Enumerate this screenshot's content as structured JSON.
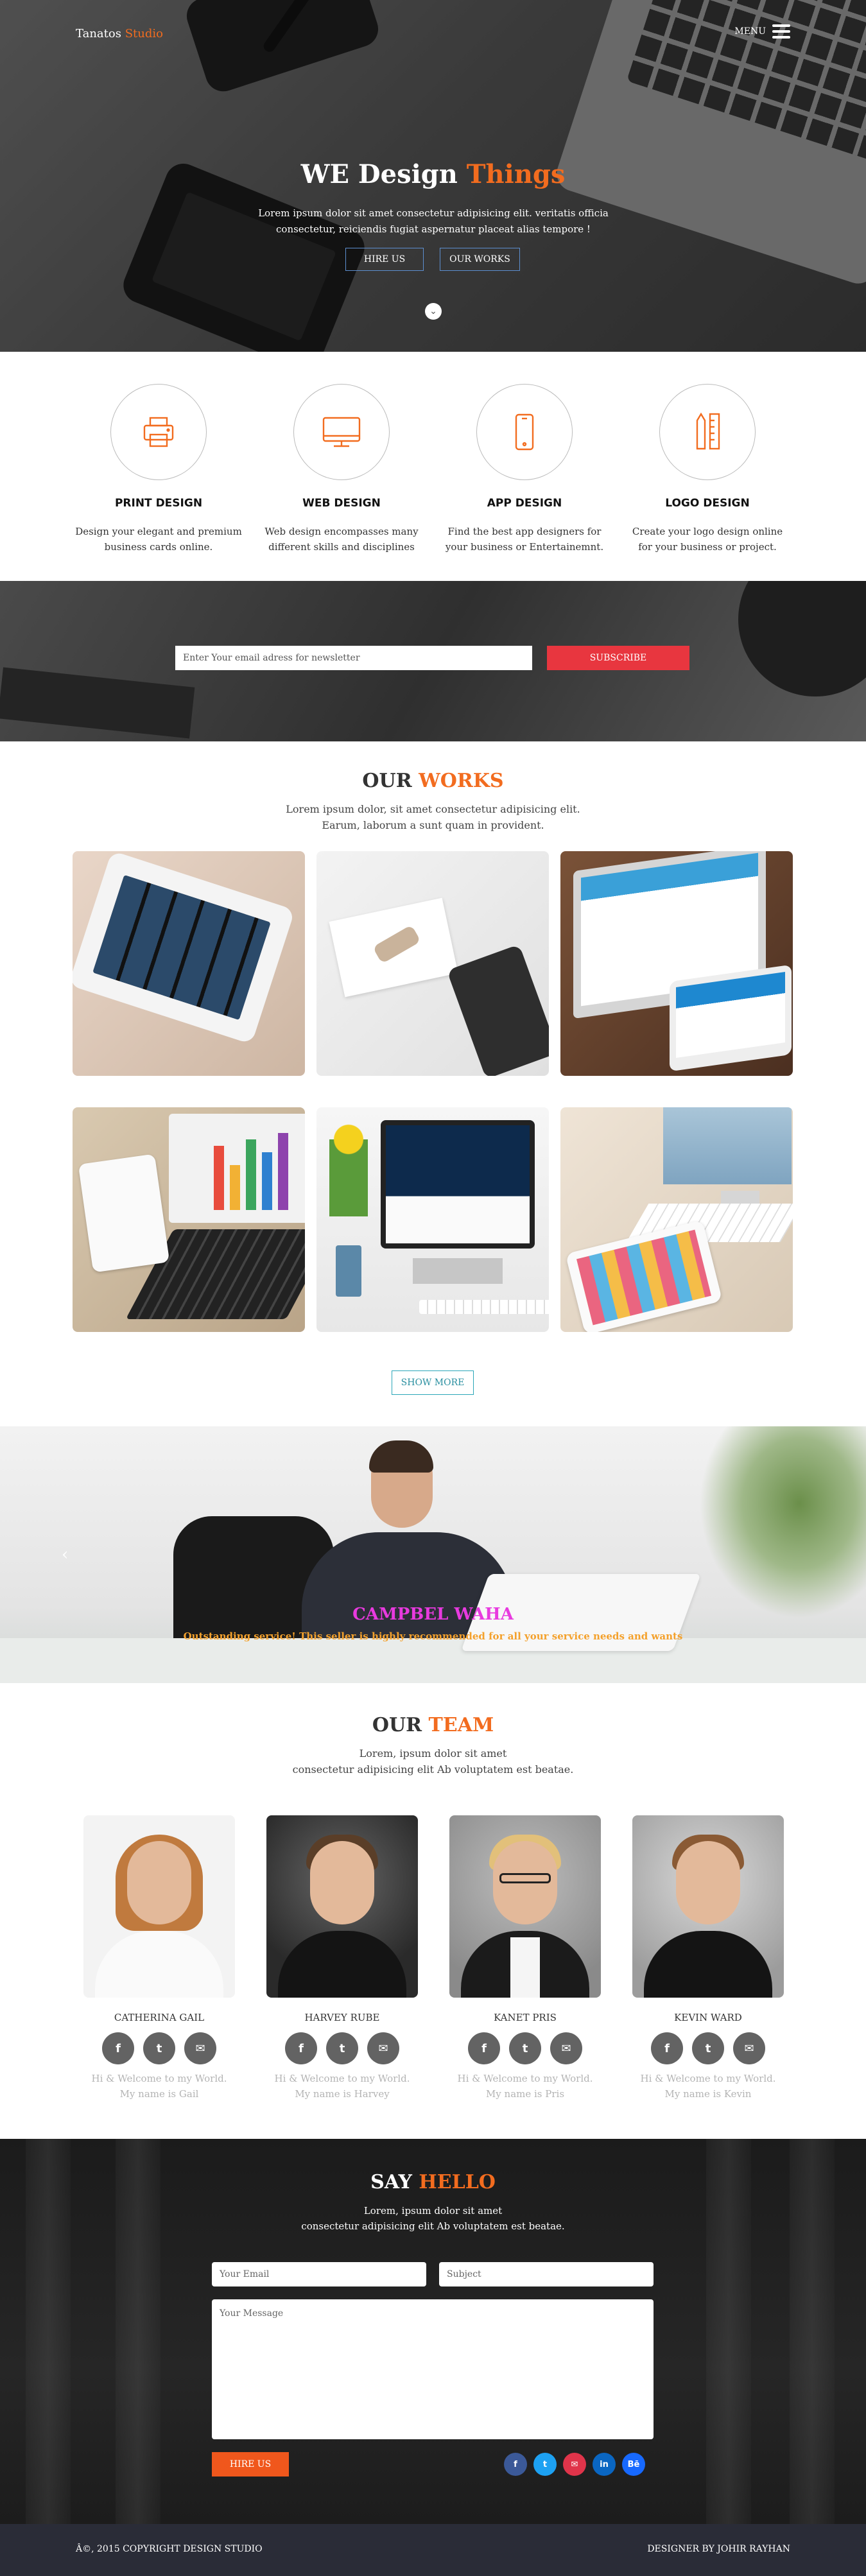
{
  "nav": {
    "brand_main": "Tanatos",
    "brand_accent": "Studio",
    "menu_label": "MENU"
  },
  "hero": {
    "title_main": "WE Design",
    "title_accent": "Things",
    "subtitle": "Lorem ipsum dolor sit amet consectetur adipisicing elit. veritatis officia consectetur, reiciendis fugiat aspernatur placeat alias tempore !",
    "btn_hire": "HIRE US",
    "btn_works": "OUR WORKS"
  },
  "services": [
    {
      "title": "PRINT DESIGN",
      "text": "Design your elegant and premium business cards online.",
      "icon": "printer-icon"
    },
    {
      "title": "WEB DESIGN",
      "text": "Web design encompasses many different skills and disciplines",
      "icon": "monitor-icon"
    },
    {
      "title": "APP DESIGN",
      "text": "Find the best app designers for your business or Entertainemnt.",
      "icon": "mobile-icon"
    },
    {
      "title": "LOGO DESIGN",
      "text": "Create your logo design online for your business or project.",
      "icon": "pencil-ruler-icon"
    }
  ],
  "newsletter": {
    "placeholder": "Enter Your email adress for newsletter",
    "button": "SUBSCRIBE"
  },
  "works": {
    "title_main": "OUR",
    "title_accent": "WORKS",
    "subtitle": "Lorem ipsum dolor, sit amet consectetur adipisicing elit. Earum, laborum a sunt quam in provident.",
    "show_more": "SHOW MORE"
  },
  "testimonial": {
    "name": "CAMPBEL WAHA",
    "text": "Outstanding service! This seller is highly recommended for all your service needs and wants"
  },
  "team": {
    "title_main": "OUR",
    "title_accent": "TEAM",
    "subtitle_1": "Lorem, ipsum dolor sit amet",
    "subtitle_2": "consectetur adipisicing elit Ab voluptatem est beatae.",
    "members": [
      {
        "name": "CATHERINA GAIL",
        "intro_1": "Hi & Welcome to my World.",
        "intro_2": "My name is Gail"
      },
      {
        "name": "HARVEY RUBE",
        "intro_1": "Hi & Welcome to my World.",
        "intro_2": "My name is Harvey"
      },
      {
        "name": "KANET PRIS",
        "intro_1": "Hi & Welcome to my World.",
        "intro_2": "My name is Pris"
      },
      {
        "name": "KEVIN WARD",
        "intro_1": "Hi & Welcome to my World.",
        "intro_2": "My name is Kevin"
      }
    ]
  },
  "contact": {
    "title_main": "SAY",
    "title_accent": "HELLO",
    "subtitle_1": "Lorem, ipsum dolor sit amet",
    "subtitle_2": "consectetur adipisicing elit Ab voluptatem est beatae.",
    "email_placeholder": "Your Email",
    "subject_placeholder": "Subject",
    "message_placeholder": "Your Message",
    "button": "HIRE US",
    "social": [
      {
        "glyph": "f",
        "color": "#3b5998",
        "icon": "facebook-icon"
      },
      {
        "glyph": "t",
        "color": "#1da1f2",
        "icon": "twitter-icon"
      },
      {
        "glyph": "✉",
        "color": "#e0344a",
        "icon": "email-icon"
      },
      {
        "glyph": "in",
        "color": "#0a66c2",
        "icon": "linkedin-icon"
      },
      {
        "glyph": "Bē",
        "color": "#1769ff",
        "icon": "behance-icon"
      }
    ]
  },
  "footer": {
    "copyright": "Â©, 2015 COPYRIGHT DESIGN STUDIO",
    "designer": "DESIGNER BY JOHIR RAYHAN"
  },
  "colors": {
    "accent": "#f26c1f",
    "subscribe": "#e8363f",
    "footer": "#2a2c37"
  }
}
